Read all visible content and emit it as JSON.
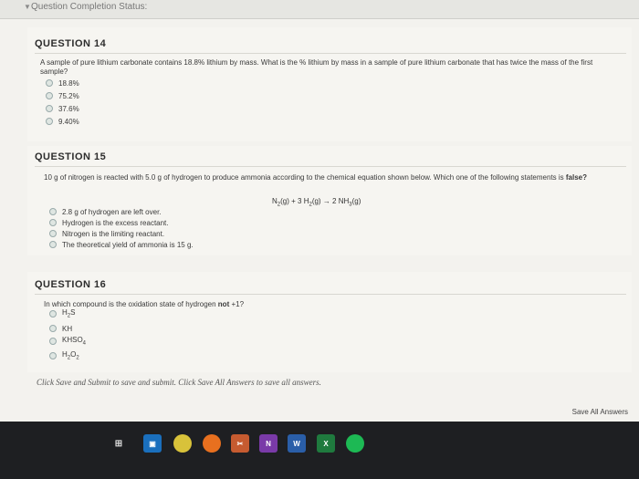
{
  "status_bar": {
    "label": "Question Completion Status:"
  },
  "questions": [
    {
      "title": "QUESTION 14",
      "text": "A sample of pure lithium carbonate contains 18.8% lithium by mass. What is the % lithium by mass in a sample of pure lithium carbonate that has twice the mass of the first sample?",
      "options": [
        "18.8%",
        "75.2%",
        "37.6%",
        "9.40%"
      ]
    },
    {
      "title": "QUESTION 15",
      "text_before": "10 g of nitrogen is reacted with 5.0 g of hydrogen to produce ammonia according to the chemical equation shown below. Which one of the following statements is ",
      "text_bold": "false?",
      "equation": "N2(g) + 3 H2(g) → 2 NH3(g)",
      "options": [
        "2.8 g of hydrogen are left over.",
        "Hydrogen is the excess reactant.",
        "Nitrogen is the limiting reactant.",
        "The theoretical yield of ammonia is 15 g."
      ]
    },
    {
      "title": "QUESTION 16",
      "text_before": "In which compound is the oxidation state of hydrogen ",
      "text_bold": "not",
      "text_after": " +1?",
      "options": [
        "H2S",
        "KH",
        "KHSO4",
        "H2O2"
      ]
    }
  ],
  "footer": {
    "note": "Click Save and Submit to save and submit. Click Save All Answers to save all answers.",
    "save_all_label": "Save All Answers"
  },
  "taskbar": {
    "icons": [
      "task-view-icon",
      "photos-icon",
      "chrome-icon",
      "firefox-icon",
      "snipping-tool-icon",
      "onenote-icon",
      "word-icon",
      "excel-icon",
      "spotify-icon"
    ],
    "labels": {
      "onenote": "N",
      "word": "W",
      "excel": "X"
    }
  }
}
